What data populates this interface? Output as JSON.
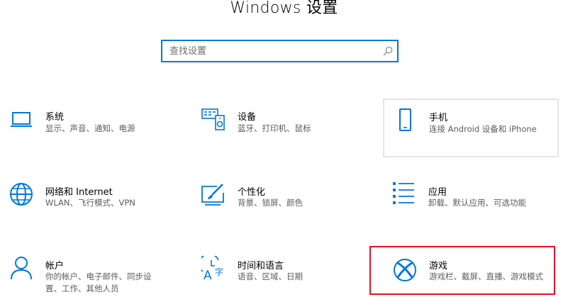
{
  "window": {
    "title": "Windows 设置"
  },
  "search": {
    "placeholder": "查找设置",
    "icon": "search-icon"
  },
  "colors": {
    "accent": "#0078d7",
    "selected_outline": "#e81123",
    "hover_outline": "#e5e5e5",
    "description_text": "#5c5c5c"
  },
  "categories": [
    {
      "id": "system",
      "title": "系统",
      "desc_lines": [
        "显示、声音、通知、电源"
      ],
      "icon": "laptop-icon"
    },
    {
      "id": "devices",
      "title": "设备",
      "desc_lines": [
        "蓝牙、打印机、鼠标"
      ],
      "icon": "keyboard-speaker-icon"
    },
    {
      "id": "phone",
      "title": "手机",
      "desc_lines": [
        "连接 Android 设备和 iPhone"
      ],
      "icon": "phone-icon"
    },
    {
      "id": "network",
      "title": "网络和 Internet",
      "desc_lines": [
        "WLAN、飞行模式、VPN"
      ],
      "icon": "globe-icon"
    },
    {
      "id": "personalization",
      "title": "个性化",
      "desc_lines": [
        "背景、锁屏、颜色"
      ],
      "icon": "paint-brush-icon"
    },
    {
      "id": "apps",
      "title": "应用",
      "desc_lines": [
        "卸载、默认应用、可选功能"
      ],
      "icon": "apps-list-icon"
    },
    {
      "id": "accounts",
      "title": "帐户",
      "desc_lines": [
        "你的帐户、电子邮件、同步设",
        "置、工作、其他人员"
      ],
      "icon": "person-icon"
    },
    {
      "id": "time-language",
      "title": "时间和语言",
      "desc_lines": [
        "语音、区域、日期"
      ],
      "icon": "time-language-icon"
    },
    {
      "id": "gaming",
      "title": "游戏",
      "desc_lines": [
        "游戏栏、截屏、直播、游戏模式"
      ],
      "icon": "xbox-icon",
      "selected": true
    }
  ]
}
